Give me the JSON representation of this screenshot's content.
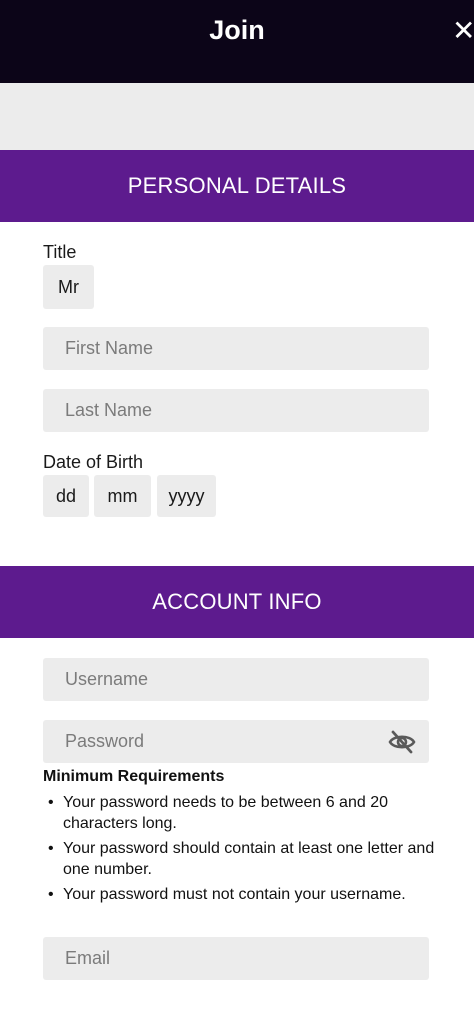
{
  "header": {
    "title": "Join",
    "close_icon": "close-icon"
  },
  "personal_details": {
    "heading": "PERSONAL DETAILS",
    "title_label": "Title",
    "title_value": "Mr",
    "first_name_placeholder": "First Name",
    "last_name_placeholder": "Last Name",
    "dob_label": "Date of Birth",
    "dob_day": "dd",
    "dob_month": "mm",
    "dob_year": "yyyy"
  },
  "account_info": {
    "heading": "ACCOUNT INFO",
    "username_placeholder": "Username",
    "password_placeholder": "Password",
    "password_toggle_icon": "eye-off-icon",
    "requirements_title": "Minimum Requirements",
    "requirements": [
      "Your password needs to be between 6 and 20 characters long.",
      "Your password should contain at least one letter and one number.",
      "Your password must not contain your username."
    ],
    "email_placeholder": "Email"
  },
  "colors": {
    "header_bg": "#0c0518",
    "section_bg": "#5d1b8e",
    "field_bg": "#ececec"
  }
}
